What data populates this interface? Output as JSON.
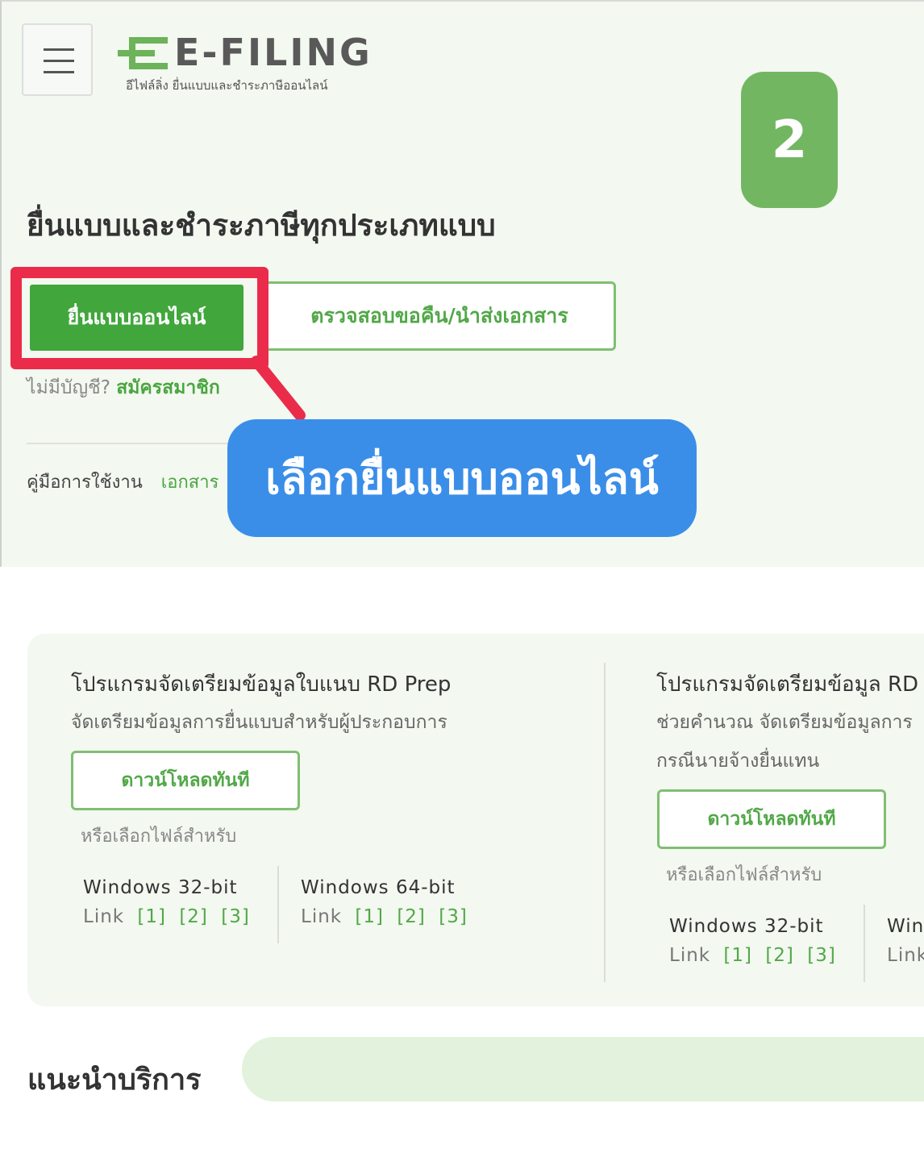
{
  "header": {
    "logo_text": "E-FILING",
    "logo_subtitle": "อีไฟล์ลิ่ง ยื่นแบบและชำระภาษีออนไลน์"
  },
  "step_badge": "2",
  "hero": {
    "heading": "ยื่นแบบและชำระภาษีทุกประเภทแบบ",
    "primary_button": "ยื่นแบบออนไลน์",
    "secondary_button": "ตรวจสอบขอคืน/นำส่งเอกสาร",
    "no_account_text": "ไม่มีบัญชี?",
    "register_link": "สมัครสมาชิก",
    "manual_label": "คู่มือการใช้งาน",
    "manual_link": "เอกสาร"
  },
  "callout": "เลือกยื่นแบบออนไลน์",
  "programs": [
    {
      "title": "โปรแกรมจัดเตรียมข้อมูลใบแนบ RD Prep",
      "desc_lines": [
        "จัดเตรียมข้อมูลการยื่นแบบสำหรับผู้ประกอบการ"
      ],
      "download_button": "ดาวน์โหลดทันที",
      "choose_text": "หรือเลือกไฟล์สำหรับ",
      "windows": [
        {
          "label": "Windows 32-bit",
          "link_prefix": "Link",
          "links": [
            "[1]",
            "[2]",
            "[3]"
          ]
        },
        {
          "label": "Windows 64-bit",
          "link_prefix": "Link",
          "links": [
            "[1]",
            "[2]",
            "[3]"
          ]
        }
      ]
    },
    {
      "title": "โปรแกรมจัดเตรียมข้อมูล RD",
      "desc_lines": [
        "ช่วยคำนวณ จัดเตรียมข้อมูลการ",
        "กรณีนายจ้างยื่นแทน"
      ],
      "download_button": "ดาวน์โหลดทันที",
      "choose_text": "หรือเลือกไฟล์สำหรับ",
      "windows": [
        {
          "label": "Windows 32-bit",
          "link_prefix": "Link",
          "links": [
            "[1]",
            "[2]",
            "[3]"
          ]
        },
        {
          "label": "Win",
          "link_prefix": "Link",
          "links": []
        }
      ]
    }
  ],
  "services": {
    "title": "แนะนำบริการ"
  },
  "colors": {
    "brand_green": "#41a63c",
    "highlight_red": "#ea2c4a",
    "callout_blue": "#3a8ee8",
    "badge_green": "#73b662"
  }
}
